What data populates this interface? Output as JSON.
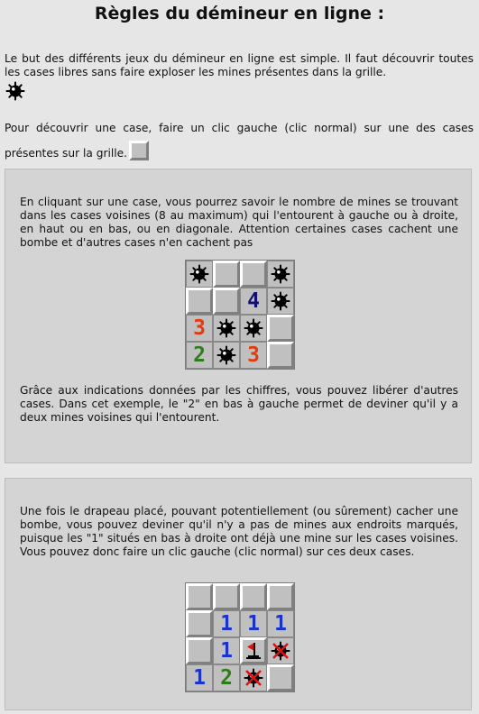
{
  "title": "Règles du démineur en ligne :",
  "intro": {
    "paragraph1": "Le but des différents jeux du démineur en ligne est simple. Il faut découvrir toutes les cases libres sans faire exploser les mines présentes dans la grille.",
    "paragraph2": "Pour découvrir une case, faire un clic gauche (clic normal) sur une des cases présentes sur la grille."
  },
  "section1": {
    "text_top": "En cliquant sur une case, vous pourrez savoir le nombre de mines se trouvant dans les cases voisines (8 au maximum) qui l'entourent à gauche ou à droite, en haut ou en bas, ou en diagonale. Attention certaines cases cachent une bombe et d'autres cases n'en cachent pas",
    "text_bottom": "Grâce aux indications données par les chiffres, vous pouvez libérer d'autres cases. Dans cet exemple, le \"2\" en bas à gauche permet de deviner qu'il y a deux mines voisines qui l'entourent.",
    "grid": [
      [
        "mine-icon",
        "raised",
        "raised",
        "mine-icon"
      ],
      [
        "raised",
        "raised",
        "4",
        "mine-icon"
      ],
      [
        "3",
        "mine-icon",
        "mine-icon",
        "raised"
      ],
      [
        "2",
        "mine-icon",
        "3",
        "raised"
      ]
    ]
  },
  "section2": {
    "text_top": "Une fois le drapeau placé, pouvant potentiellement (ou sûrement) cacher une bombe, vous pouvez deviner qu'il n'y a pas de mines aux endroits marqués, puisque les \"1\" situés en bas à droite ont déjà une mine sur les cases voisines. Vous pouvez donc faire un clic gauche (clic normal) sur ces deux cases.",
    "grid": [
      [
        "raised",
        "raised",
        "raised",
        "raised"
      ],
      [
        "raised",
        "1",
        "1",
        "1"
      ],
      [
        "raised",
        "1",
        "flag-icon",
        "crossed-icon"
      ],
      [
        "1",
        "2",
        "crossed-icon",
        "raised"
      ]
    ]
  },
  "colors": {
    "1": "#1a33cc",
    "2": "#2e7d1a",
    "3": "#e03c10",
    "4": "#101070"
  }
}
